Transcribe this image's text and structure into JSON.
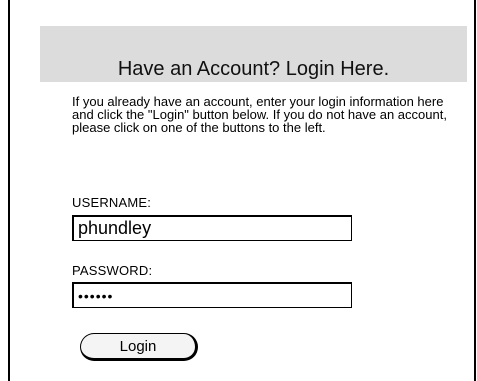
{
  "header": {
    "title": "Have an Account? Login Here."
  },
  "intro": {
    "text": "If you already have an account, enter your login information here and click the \"Login\" button below. If you do not have an account, please click on one of the buttons to the left."
  },
  "form": {
    "username_label": "USERNAME:",
    "username_value": "phundley",
    "password_label": "PASSWORD:",
    "password_value": "••••••",
    "login_label": "Login"
  },
  "colors": {
    "header_background": "#dcdcdc",
    "border": "#000000",
    "background": "#ffffff"
  }
}
